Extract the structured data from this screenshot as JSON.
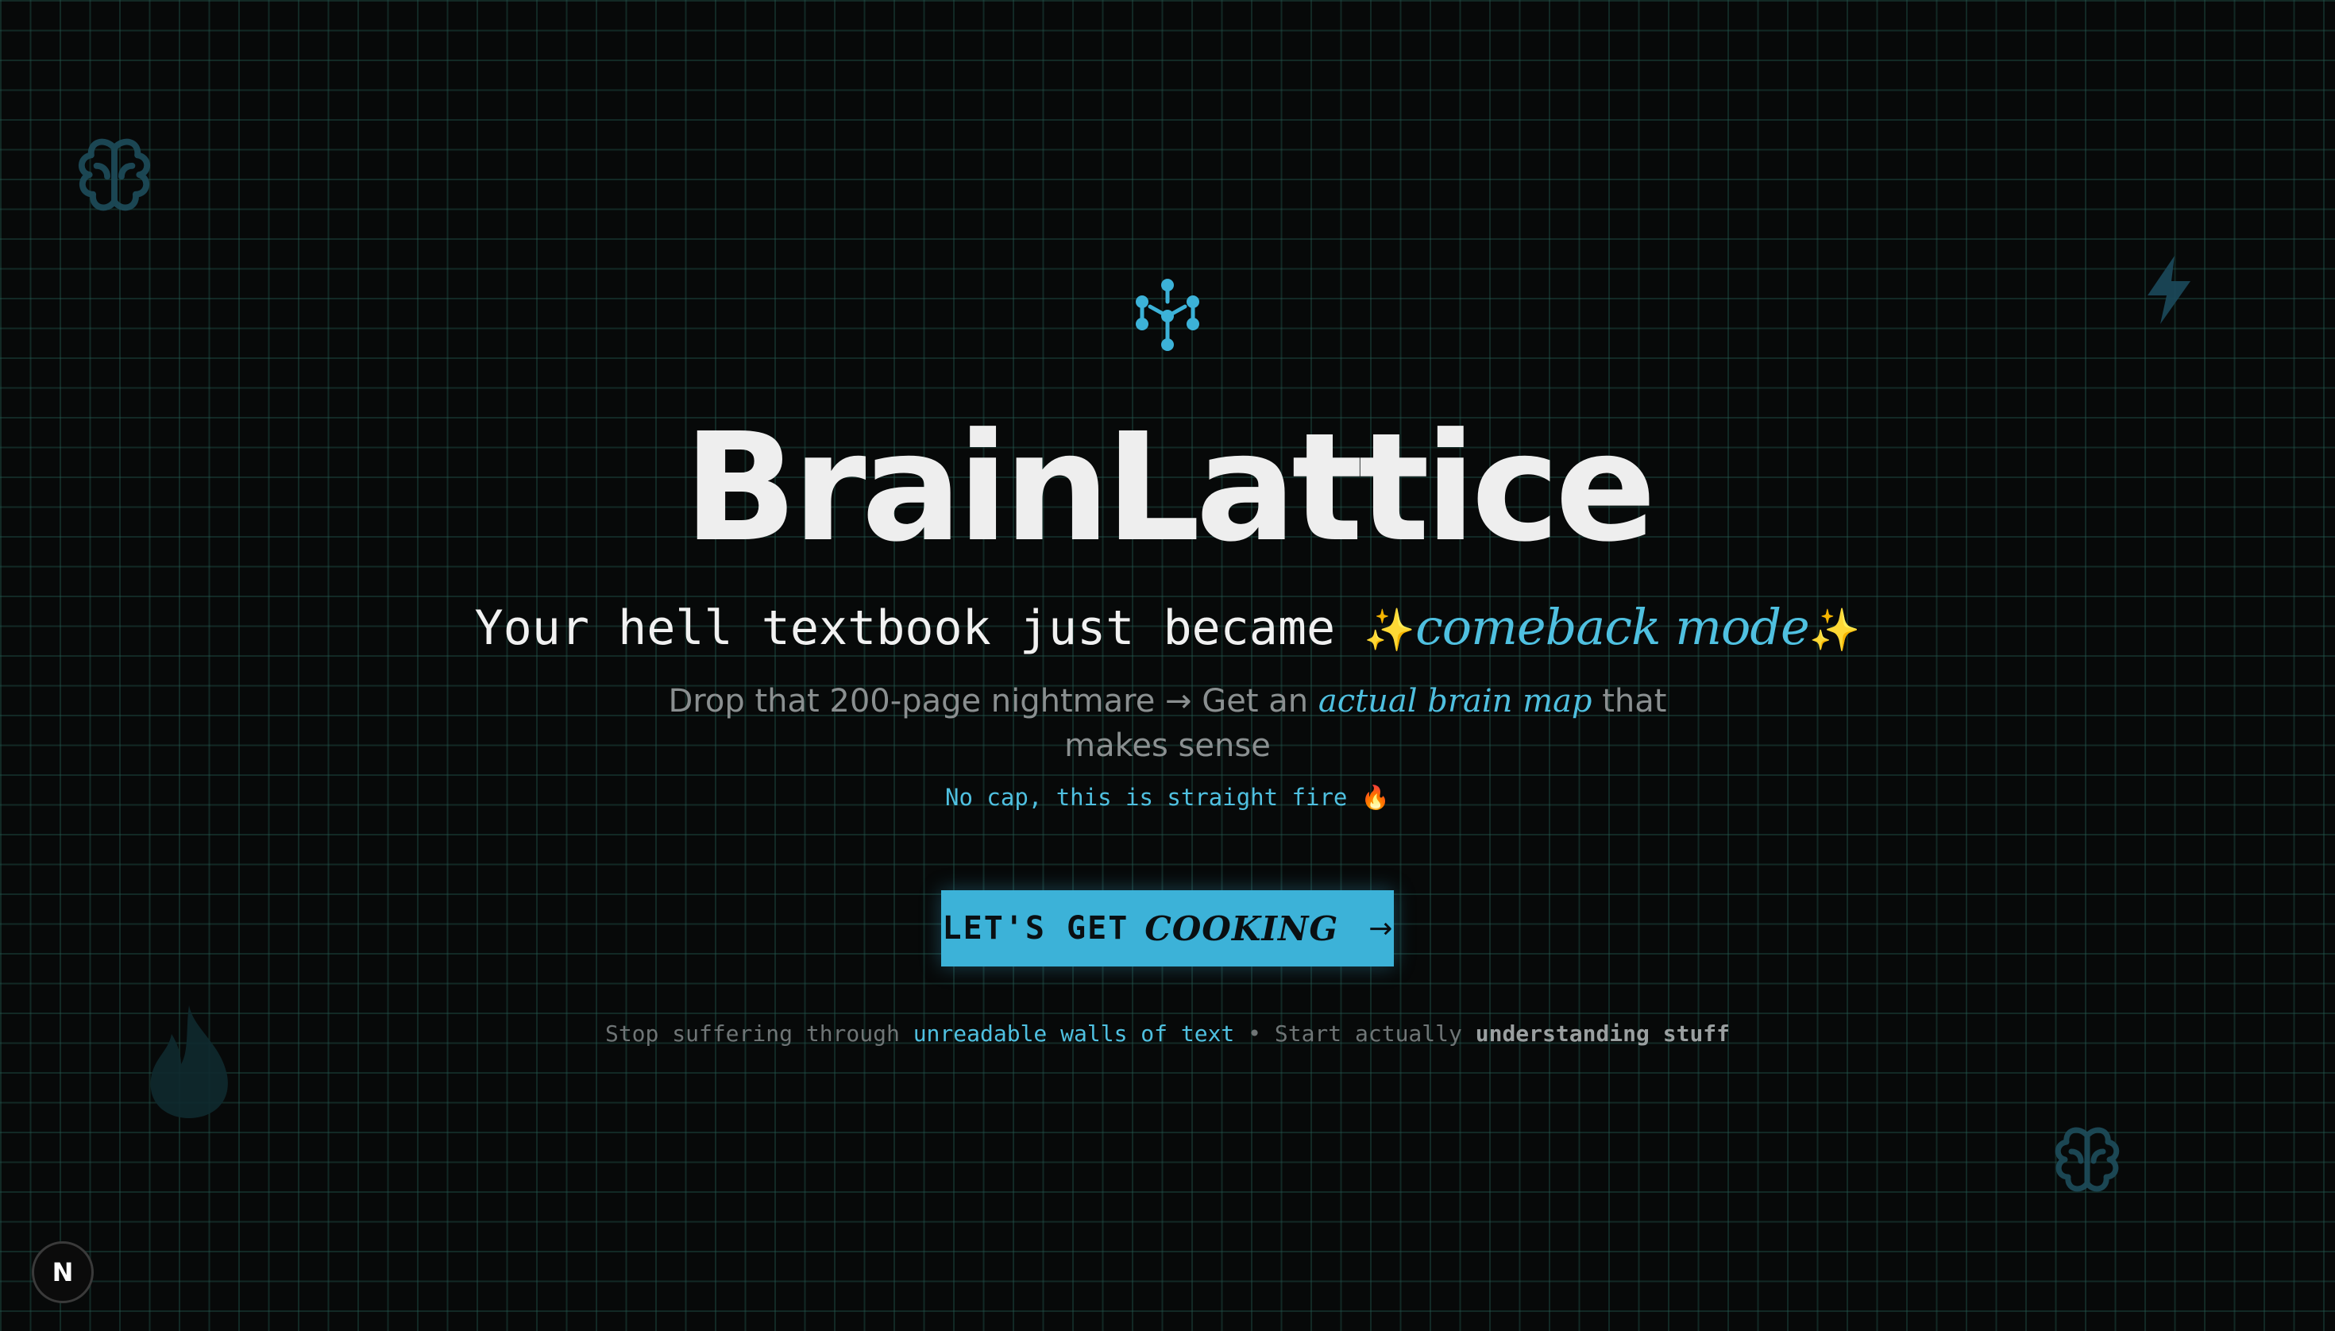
{
  "brand": {
    "title": "BrainLattice",
    "logo_icon": "network-nodes-icon",
    "accent_color": "#3cb2d8"
  },
  "hero": {
    "tagline_main": "Your hell textbook just became ",
    "tagline_spark_left": "✨",
    "tagline_accent": "comeback mode",
    "tagline_spark_right": "✨",
    "subline_part1": "Drop that 200-page nightmare → Get an ",
    "subline_accent": "actual brain map",
    "subline_part2": " that makes sense",
    "nocap": "No cap, this is straight fire 🔥"
  },
  "cta": {
    "label": "LET'S GET ",
    "label_emphasis": "COOKING",
    "arrow": "→"
  },
  "footer": {
    "part1": "Stop suffering through ",
    "accent": "unreadable walls of text",
    "separator": " • ",
    "part2": "Start actually ",
    "strong": "understanding stuff"
  },
  "decorations": {
    "icons": [
      "brain-icon",
      "lightning-bolt-icon",
      "flame-icon",
      "brain-icon"
    ]
  },
  "dev_badge": {
    "letter": "N",
    "icon": "nextjs-logo-icon"
  }
}
